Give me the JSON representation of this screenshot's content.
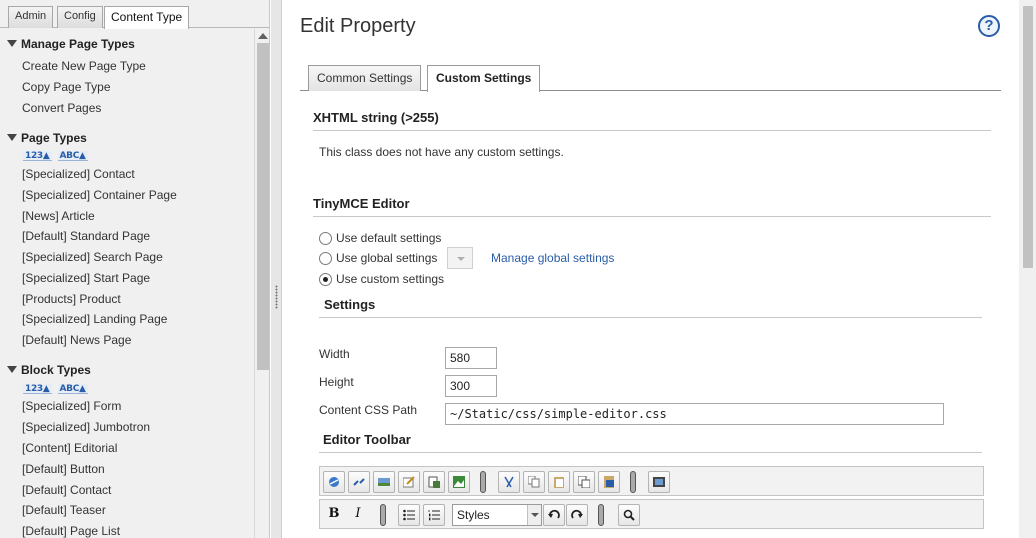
{
  "left_tabs": [
    "Admin",
    "Config",
    "Content Type"
  ],
  "sort_labels": {
    "numeric": "123▲",
    "alpha": "ABC▲"
  },
  "sections": {
    "manage": {
      "title": "Manage Page Types",
      "items": [
        "Create New Page Type",
        "Copy Page Type",
        "Convert Pages"
      ]
    },
    "page_types": {
      "title": "Page Types",
      "items": [
        "[Specialized] Contact",
        "[Specialized] Container Page",
        "[News] Article",
        "[Default] Standard Page",
        "[Specialized] Search Page",
        "[Specialized] Start Page",
        "[Products] Product",
        "[Specialized] Landing Page",
        "[Default] News Page"
      ]
    },
    "block_types": {
      "title": "Block Types",
      "items": [
        "[Specialized] Form",
        "[Specialized] Jumbotron",
        "[Content] Editorial",
        "[Default] Button",
        "[Default] Contact",
        "[Default] Teaser",
        "[Default] Page List"
      ]
    }
  },
  "page_title": "Edit Property",
  "help_label": "?",
  "right_tabs": [
    "Common Settings",
    "Custom Settings"
  ],
  "xhtml_section": {
    "heading": "XHTML string (>255)",
    "message": "This class does not have any custom settings."
  },
  "tinymce_section": {
    "heading": "TinyMCE Editor",
    "options": [
      "Use default settings",
      "Use global settings",
      "Use custom settings"
    ],
    "selected_option": "Use custom settings",
    "manage_link": "Manage global settings"
  },
  "settings": {
    "heading": "Settings",
    "width_label": "Width",
    "width_value": "580",
    "height_label": "Height",
    "height_value": "300",
    "css_label": "Content CSS Path",
    "css_value": "~/Static/css/simple-editor.css"
  },
  "editor_toolbar": {
    "heading": "Editor Toolbar",
    "row1_icons": [
      "link-icon",
      "unlink-icon",
      "image-icon",
      "edit-icon",
      "paste-document-icon",
      "picture-icon",
      "cut-icon",
      "copy-icon",
      "paste-icon",
      "paste-text-icon",
      "paste-word-icon",
      "media-icon"
    ],
    "row2": {
      "bold": "B",
      "italic": "I",
      "styles": "Styles"
    }
  }
}
